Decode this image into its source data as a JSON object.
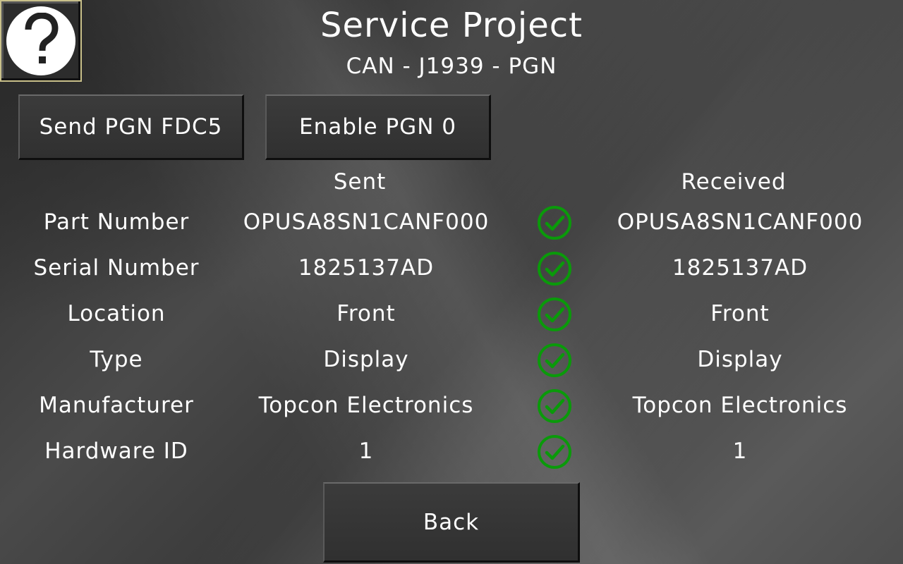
{
  "header": {
    "title": "Service Project",
    "subtitle": "CAN - J1939 - PGN"
  },
  "help": {
    "icon": "question-mark-icon"
  },
  "buttons": {
    "send_pgn": "Send PGN FDC5",
    "enable_pgn": "Enable PGN 0",
    "back": "Back"
  },
  "table": {
    "sent_header": "Sent",
    "received_header": "Received",
    "match_icon": "check-circle-icon",
    "match_color": "#0a9a0a",
    "rows": [
      {
        "label": "Part Number",
        "sent": "OPUSA8SN1CANF000",
        "received": "OPUSA8SN1CANF000",
        "match": true
      },
      {
        "label": "Serial Number",
        "sent": "1825137AD",
        "received": "1825137AD",
        "match": true
      },
      {
        "label": "Location",
        "sent": "Front",
        "received": "Front",
        "match": true
      },
      {
        "label": "Type",
        "sent": "Display",
        "received": "Display",
        "match": true
      },
      {
        "label": "Manufacturer",
        "sent": "Topcon Electronics",
        "received": "Topcon Electronics",
        "match": true
      },
      {
        "label": "Hardware ID",
        "sent": "1",
        "received": "1",
        "match": true
      }
    ]
  }
}
